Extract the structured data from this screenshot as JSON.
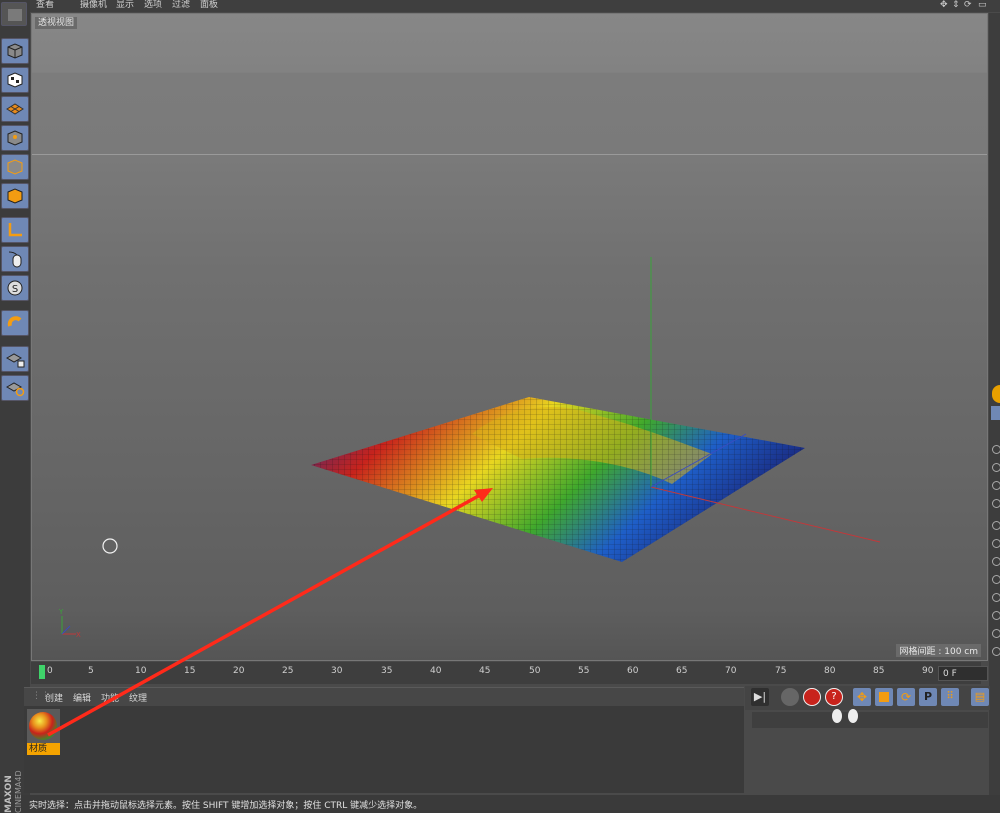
{
  "menu": {
    "items": [
      "查看",
      "摄像机",
      "显示",
      "选项",
      "过滤",
      "面板"
    ]
  },
  "viewport": {
    "label": "透视视图",
    "grid_spacing": "网格间距 : 100 cm",
    "surface_colors": [
      "#1a2a9a",
      "#c8231c",
      "#e6d21c",
      "#4cb52a",
      "#1e5bd0"
    ]
  },
  "timeline": {
    "ticks": [
      "0",
      "5",
      "10",
      "15",
      "20",
      "25",
      "30",
      "35",
      "40",
      "45",
      "50",
      "55",
      "60",
      "65",
      "70",
      "75",
      "80",
      "85",
      "90"
    ],
    "current_frame": "0 F"
  },
  "material_manager": {
    "menu": [
      "创建",
      "编辑",
      "功能",
      "纹理"
    ],
    "material_name": "材质"
  },
  "status": {
    "text": "实时选择：点击并拖动鼠标选择元素。按住 SHIFT 键增加选择对象；按住 CTRL 键减少选择对象。"
  },
  "logo": {
    "text": "MAXON CINEMA4D"
  },
  "tools": [
    "model-icon",
    "texture-icon",
    "workplane-icon",
    "points-icon",
    "edges-icon",
    "polygons-icon",
    "axis-icon",
    "mouse-icon",
    "snap-s-icon",
    "magnet-icon",
    "lock-workplane-icon",
    "workplane-snap-icon"
  ],
  "colors": {
    "annotation_arrow": "#ff2a1a",
    "material_label_bg": "#f4a300"
  }
}
